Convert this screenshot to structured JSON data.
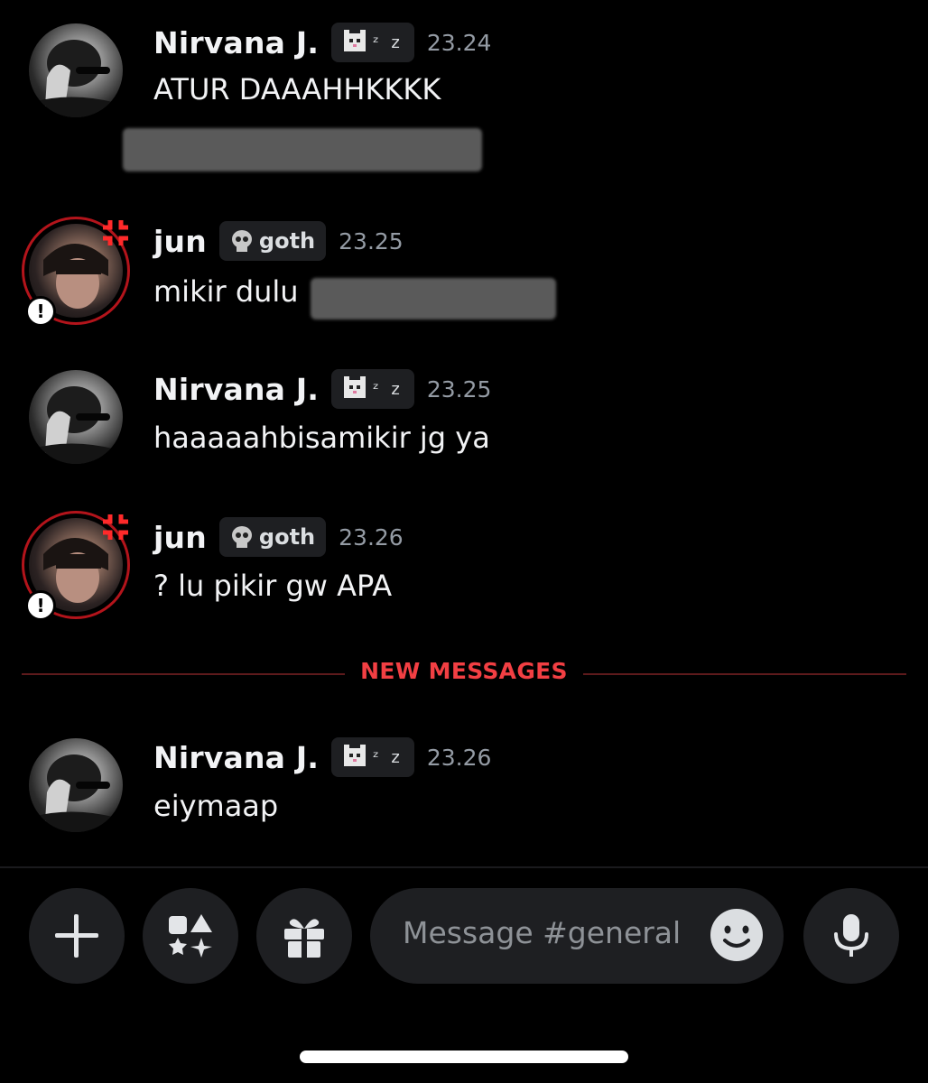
{
  "messages": [
    {
      "author": "Nirvana J.",
      "tag": {
        "icon": "pixel-cat-icon",
        "suffix": "ᶻ z"
      },
      "time": "23.24",
      "text": "ATUR DAAAHHKKKK",
      "redacted_second_line": true
    },
    {
      "author": "jun",
      "tag": {
        "icon": "skull-icon",
        "label": "goth"
      },
      "time": "23.25",
      "text": "mikir dulu "
    },
    {
      "author": "Nirvana J.",
      "tag": {
        "icon": "pixel-cat-icon",
        "suffix": "ᶻ z"
      },
      "time": "23.25",
      "text": "haaaaahbisamikir jg ya"
    },
    {
      "author": "jun",
      "tag": {
        "icon": "skull-icon",
        "label": "goth"
      },
      "time": "23.26",
      "text": "? lu pikir gw APA"
    },
    {
      "author": "Nirvana J.",
      "tag": {
        "icon": "pixel-cat-icon",
        "suffix": "ᶻ z"
      },
      "time": "23.26",
      "text": "eiymaap"
    }
  ],
  "divider": {
    "label": "NEW MESSAGES",
    "color": "#f23f43"
  },
  "composer": {
    "placeholder": "Message #general",
    "buttons": [
      "plus-icon",
      "apps-icon",
      "gift-icon",
      "emoji-icon",
      "microphone-icon"
    ]
  },
  "colors": {
    "background": "#000000",
    "accent_red": "#f23f43",
    "timestamp": "#949ba4",
    "pill": "#1e1f22"
  }
}
